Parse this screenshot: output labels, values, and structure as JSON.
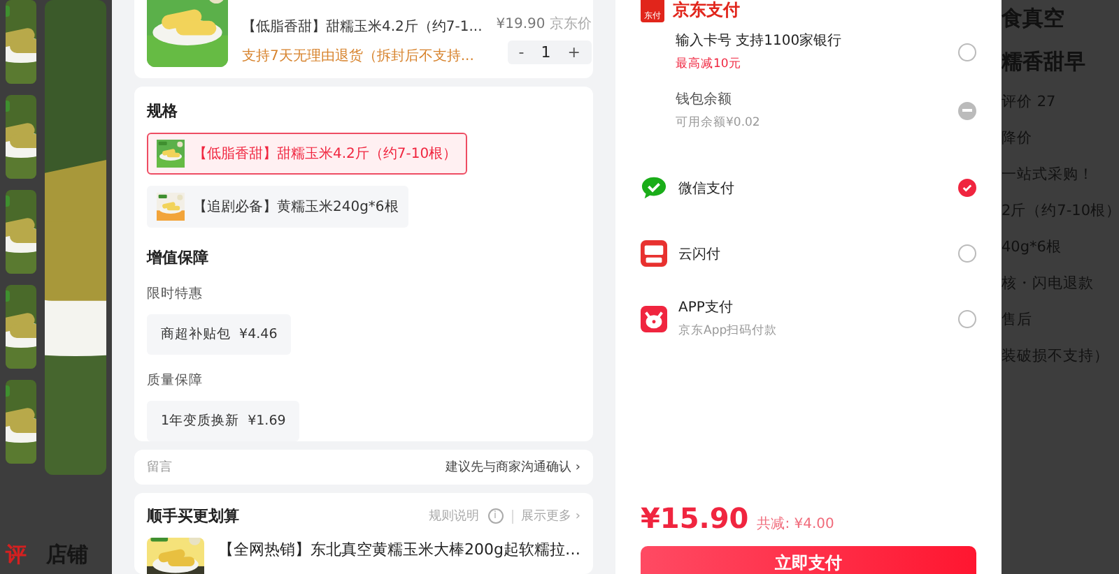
{
  "background_page": {
    "left_tabs": [
      {
        "label": "评",
        "selected": true
      },
      {
        "label": "店铺",
        "selected": false
      }
    ],
    "right_texts": [
      "食真空",
      "糯香甜早",
      "评价 27",
      "降价",
      "一站式采购！",
      "2斤（约7-10根）",
      "40g*6根",
      "核・闪电退款",
      "售后",
      "装破损不支持）"
    ]
  },
  "product": {
    "title": "【低脂香甜】甜糯玉米4.2斤（约7-1...",
    "note": "支持7天无理由退货（拆封后不支持...",
    "price": "¥19.90",
    "price_label": "京东价",
    "minus": "-",
    "quantity": "1",
    "plus": "+"
  },
  "specs": {
    "heading": "规格",
    "options": [
      {
        "label": "【低脂香甜】甜糯玉米4.2斤（约7-10根）",
        "selected": true
      },
      {
        "label": "【追剧必备】黄糯玉米240g*6根",
        "selected": false
      }
    ]
  },
  "value_added": {
    "heading": "增值保障",
    "groups": [
      {
        "title": "限时特惠",
        "chip": "商超补贴包  ¥4.46"
      },
      {
        "title": "质量保障",
        "chip": "1年变质换新  ¥1.69"
      }
    ]
  },
  "message": {
    "label": "留言",
    "hint": "建议先与商家沟通确认",
    "arrow": "›"
  },
  "bundle": {
    "title": "顺手买更划算",
    "rules": "规则说明",
    "info": "i",
    "more": "展示更多",
    "arrow": "›",
    "item": "【全网热销】东北真空黄糯玉米大棒200g起软糯拉…"
  },
  "payment": {
    "title": "京东支付",
    "logo_text": "东付",
    "methods": [
      {
        "kind": "card",
        "name": "输入卡号 支持1100家银行",
        "sub": "最高减10元",
        "selected": false,
        "disabled": false
      },
      {
        "kind": "wallet",
        "name": "钱包余额",
        "sub": "可用余额¥0.02",
        "selected": false,
        "disabled": true
      },
      {
        "kind": "wechat",
        "name": "微信支付",
        "selected": true,
        "disabled": false
      },
      {
        "kind": "unionpay",
        "name": "云闪付",
        "selected": false,
        "disabled": false
      },
      {
        "kind": "app",
        "name": "APP支付",
        "sub": "京东App扫码付款",
        "selected": false,
        "disabled": false
      }
    ],
    "total": "¥15.90",
    "discount": "共减: ¥4.00",
    "pay_button": "立即支付"
  }
}
